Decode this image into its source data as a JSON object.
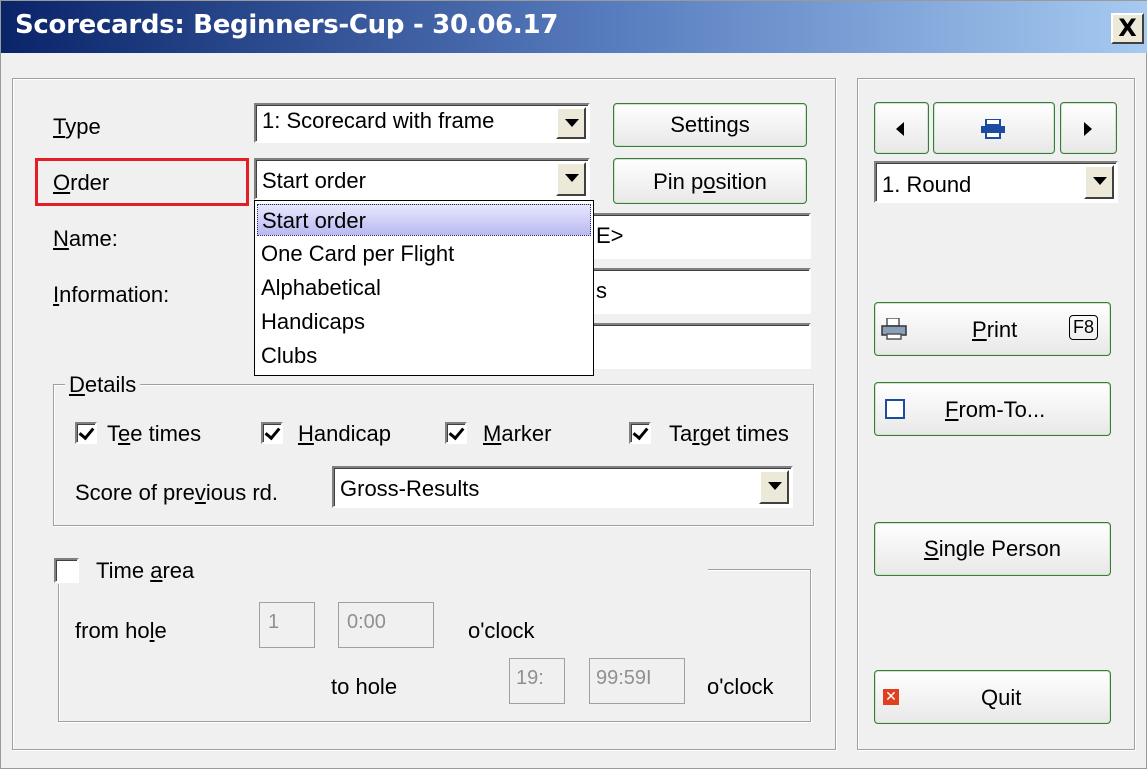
{
  "window": {
    "title": "Scorecards: Beginners-Cup - 30.06.17",
    "close_glyph": "X"
  },
  "form": {
    "type_label_u": "T",
    "type_label_rest": "ype",
    "type_value": "1: Scorecard with frame",
    "order_label_u": "O",
    "order_label_rest": "rder",
    "order_value": "Start order",
    "name_label_u": "N",
    "name_label_rest": "ame:",
    "name_value_visible": "E>",
    "information_label_u": "I",
    "information_label_rest": "nformation:",
    "information_value_visible": "s",
    "settings_button": "Settings",
    "pin_button_pre": "Pin p",
    "pin_button_u": "o",
    "pin_button_post": "sition"
  },
  "order_dropdown": {
    "options": [
      "Start order",
      "One Card per Flight",
      "Alphabetical",
      "Handicaps",
      "Clubs"
    ],
    "selected_index": 0
  },
  "details": {
    "legend_u": "D",
    "legend_rest": "etails",
    "tee_times": {
      "pre": "T",
      "u": "e",
      "post": "e times",
      "checked": true
    },
    "handicap": {
      "pre": "",
      "u": "H",
      "post": "andicap",
      "checked": true
    },
    "marker": {
      "pre": "",
      "u": "M",
      "post": "arker",
      "checked": true
    },
    "target_times": {
      "pre": "Ta",
      "u": "r",
      "post": "get times",
      "checked": true
    },
    "score_label_pre": "Score of pre",
    "score_label_u": "v",
    "score_label_post": "ious rd.",
    "score_value": "Gross-Results"
  },
  "time_area": {
    "label_pre": "Time ",
    "label_u": "a",
    "label_post": "rea",
    "checked": false,
    "from_hole_pre": "from ho",
    "from_hole_u": "l",
    "from_hole_post": "e",
    "from_hole_value": "1",
    "from_time_value": "0:00",
    "oclock1": "o'clock",
    "to_hole_label": "to hole",
    "to_hole_value": "19:",
    "to_time_value": "99:59I",
    "oclock2": "o'clock"
  },
  "right": {
    "round_value": "1. Round",
    "print_u": "P",
    "print_rest": "rint",
    "print_key": "F8",
    "fromto_u": "F",
    "fromto_rest": "rom-To...",
    "single_u": "S",
    "single_rest": "ingle Person",
    "quit": "Quit"
  },
  "colors": {
    "highlight": "#e41e26",
    "button_border": "#3a7a3a",
    "title_gradient_start": "#0a246a"
  }
}
